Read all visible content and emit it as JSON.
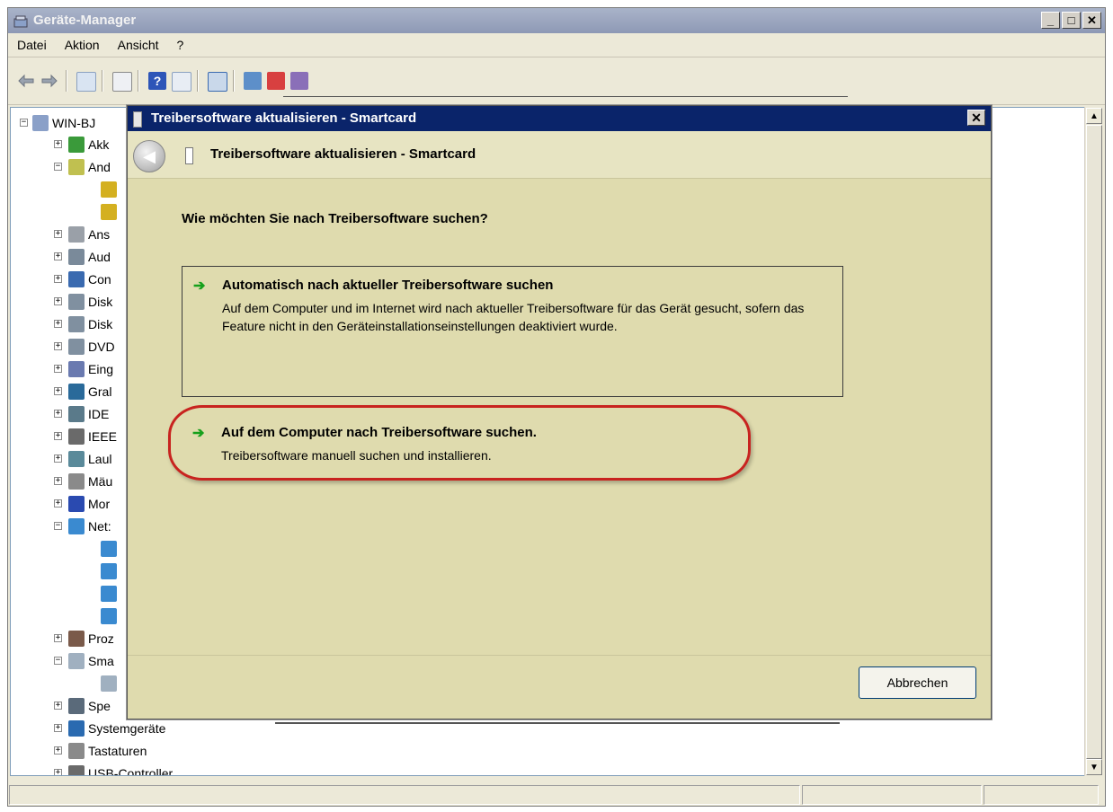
{
  "window": {
    "title": "Geräte-Manager",
    "btn_min": "_",
    "btn_max": "□",
    "btn_close": "✕"
  },
  "menu": [
    "Datei",
    "Aktion",
    "Ansicht",
    "?"
  ],
  "tree": {
    "root": "WIN-BJ",
    "items": [
      {
        "label": "Akk",
        "expander": "+"
      },
      {
        "label": "And",
        "expander": "−"
      },
      {
        "label": "",
        "expander": ""
      },
      {
        "label": "",
        "expander": ""
      },
      {
        "label": "Ans",
        "expander": "+"
      },
      {
        "label": "Aud",
        "expander": "+"
      },
      {
        "label": "Con",
        "expander": "+"
      },
      {
        "label": "Disk",
        "expander": "+"
      },
      {
        "label": "Disk",
        "expander": "+"
      },
      {
        "label": "DVD",
        "expander": "+"
      },
      {
        "label": "Eing",
        "expander": "+"
      },
      {
        "label": "Gral",
        "expander": "+"
      },
      {
        "label": "IDE",
        "expander": "+"
      },
      {
        "label": "IEEE",
        "expander": "+"
      },
      {
        "label": "Laul",
        "expander": "+"
      },
      {
        "label": "Mäu",
        "expander": "+"
      },
      {
        "label": "Mor",
        "expander": "+"
      },
      {
        "label": "Net:",
        "expander": "−"
      },
      {
        "label": "",
        "expander": ""
      },
      {
        "label": "",
        "expander": ""
      },
      {
        "label": "",
        "expander": ""
      },
      {
        "label": "",
        "expander": ""
      },
      {
        "label": "Proz",
        "expander": "+"
      },
      {
        "label": "Sma",
        "expander": "−"
      },
      {
        "label": "",
        "expander": ""
      },
      {
        "label": "Spe",
        "expander": "+"
      },
      {
        "label": "Systemgeräte",
        "expander": "+"
      },
      {
        "label": "Tastaturen",
        "expander": "+"
      },
      {
        "label": "USB-Controller",
        "expander": "+"
      }
    ]
  },
  "dialog": {
    "title": "Treibersoftware aktualisieren - Smartcard",
    "header_title": "Treibersoftware aktualisieren - Smartcard",
    "question": "Wie möchten Sie nach Treibersoftware suchen?",
    "option1": {
      "title": "Automatisch nach aktueller Treibersoftware suchen",
      "desc": "Auf dem Computer und im Internet wird nach aktueller Treibersoftware für das Gerät gesucht, sofern das Feature nicht in den Geräteinstallationseinstellungen deaktiviert wurde."
    },
    "option2": {
      "title": "Auf dem Computer nach Treibersoftware suchen.",
      "desc": "Treibersoftware manuell suchen und installieren."
    },
    "arrow": "➔",
    "cancel": "Abbrechen",
    "close": "✕",
    "back": "◀"
  },
  "colors": {
    "accent_arrow": "#16a01c",
    "highlight_ring": "#c8231f",
    "dialog_title": "#0a246a"
  }
}
